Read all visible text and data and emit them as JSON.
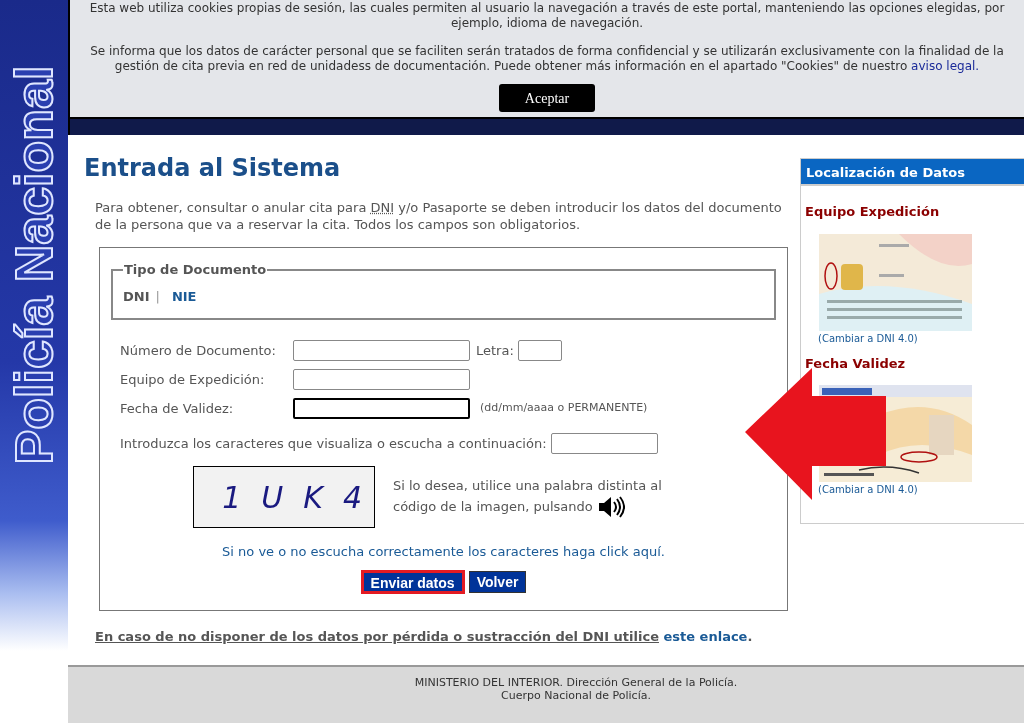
{
  "side_banner": {
    "text": "Policía Nacional"
  },
  "cookie_banner": {
    "paragraph_1": "Esta web utiliza cookies propias de sesión, las cuales permiten al usuario la navegación a través de este portal, manteniendo las opciones elegidas, por ejemplo, idioma de navegación.",
    "paragraph_2": "Se informa que los datos de carácter personal que se faciliten serán tratados de forma confidencial y se utilizarán exclusivamente con la finalidad de la gestión de cita previa en red de unidadess de documentación. Puede obtener más información en el apartado \"Cookies\" de nuestro",
    "link": "aviso legal.",
    "button": "Aceptar"
  },
  "title": "Entrada al Sistema",
  "intro": {
    "before": "Para obtener, consultar o anular cita para",
    "abbr": "DNI",
    "after": "y/o Pasaporte se deben introducir los datos del documento de la persona que va a reservar la cita. Todos los campos son obligatorios."
  },
  "document_type": {
    "legend": "Tipo de Documento",
    "separator": "|",
    "options": [
      {
        "label": "DNI",
        "selected": true
      },
      {
        "label": "NIE",
        "selected": false
      }
    ]
  },
  "fields": [
    {
      "label": "Número de Documento:",
      "focused": false,
      "extra_label": "Letra:"
    },
    {
      "label": "Equipo de Expedición:",
      "focused": false
    },
    {
      "label": "Fecha de Validez:",
      "focused": true,
      "hint": "(dd/mm/aaaa o PERMANENTE)"
    }
  ],
  "captcha": {
    "prompt": "Introduzca los caracteres que visualiza o escucha a continuación:",
    "characters": [
      "1",
      "U",
      "K",
      "4"
    ],
    "audio_text": "Si lo desea, utilice una palabra distinta al código de la imagen, pulsando",
    "help_link": "Si no ve o no escucha correctamente los caracteres haga click aquí."
  },
  "buttons": [
    {
      "label": "Enviar datos",
      "highlighted": true
    },
    {
      "label": "Volver",
      "highlighted": false
    }
  ],
  "lost_note": {
    "text": "En caso de no disponer de los datos por pérdida o sustracción del DNI utilice",
    "link": "este enlace",
    "end": "."
  },
  "sidebar": {
    "title": "Localización de Datos",
    "sections": [
      {
        "heading": "Equipo Expedición",
        "link": "(Cambiar a DNI 4.0)"
      },
      {
        "heading": "Fecha Validez",
        "link": "(Cambiar a DNI 4.0)"
      }
    ]
  },
  "footer": {
    "line_1": "MINISTERIO DEL INTERIOR. Dirección General de la Policía.",
    "line_2": "Cuerpo Nacional de Policía."
  }
}
